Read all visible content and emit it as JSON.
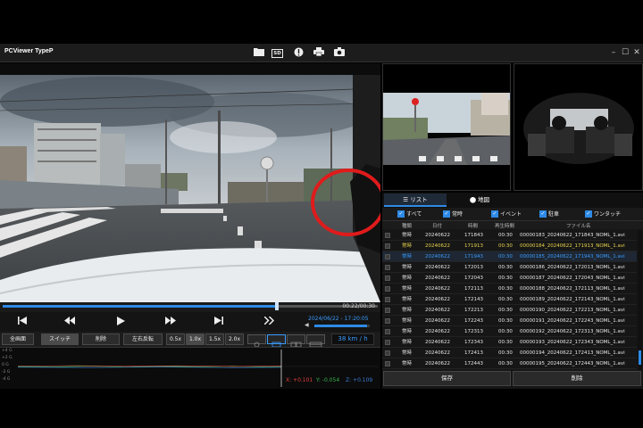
{
  "app": {
    "title": "PCViewer TypeP",
    "toolbar_icons": [
      "folder-icon",
      "sd-card-icon",
      "info-icon",
      "print-icon",
      "camera-icon"
    ],
    "sd_label": "SD",
    "window_controls": {
      "minimize": "–",
      "maximize": "☐",
      "close": "✕"
    }
  },
  "player": {
    "time": "00:22/00:30",
    "progress": 0.73,
    "volume": 0.95,
    "datetime": "2024/06/22 - 17:20:05",
    "speed": "38 km / h",
    "controls": [
      "skip-back",
      "rewind",
      "play",
      "fast-forward",
      "skip-forward",
      "next-clip"
    ]
  },
  "buttons": {
    "fullscreen": "全画面",
    "switch": "スイッチ",
    "delete": "削除",
    "mirror": "左右反転",
    "speeds": [
      "0.5x",
      "1.0x",
      "1.5x",
      "2.0x"
    ],
    "active_speed": "1.0x"
  },
  "gsensor": {
    "scale": [
      "+4 G",
      "+2 G",
      "0 G",
      "-2 G",
      "-4 G"
    ],
    "x": "X: +0.101",
    "y": "Y: -0.054",
    "z": "Z: +0.109",
    "colors": {
      "x": "#e0403c",
      "y": "#37b24d",
      "z": "#3a7bd5"
    }
  },
  "panel": {
    "tabs": {
      "list": "リスト",
      "map": "地図"
    },
    "filters": [
      "すべて",
      "常時",
      "イベント",
      "駐車",
      "ワンタッチ"
    ],
    "columns": [
      "種類",
      "日付",
      "時間",
      "再生時間",
      "ファイル名"
    ],
    "rows": [
      {
        "type": "常時",
        "date": "20240622",
        "time": "171843",
        "dur": "00:30",
        "file": "00000183_20240622_171843_NOML_1.avi",
        "state": "normal"
      },
      {
        "type": "常時",
        "date": "20240622",
        "time": "171913",
        "dur": "00:30",
        "file": "00000184_20240622_171913_NOML_1.avi",
        "state": "yellow"
      },
      {
        "type": "常時",
        "date": "20240622",
        "time": "171943",
        "dur": "00:30",
        "file": "00000185_20240622_171943_NOML_1.avi",
        "state": "selected"
      },
      {
        "type": "常時",
        "date": "20240622",
        "time": "172013",
        "dur": "00:30",
        "file": "00000186_20240622_172013_NOML_1.avi",
        "state": "normal"
      },
      {
        "type": "常時",
        "date": "20240622",
        "time": "172043",
        "dur": "00:30",
        "file": "00000187_20240622_172043_NOML_1.avi",
        "state": "normal"
      },
      {
        "type": "常時",
        "date": "20240622",
        "time": "172113",
        "dur": "00:30",
        "file": "00000188_20240622_172113_NOML_1.avi",
        "state": "normal"
      },
      {
        "type": "常時",
        "date": "20240622",
        "time": "172143",
        "dur": "00:30",
        "file": "00000189_20240622_172143_NOML_1.avi",
        "state": "normal"
      },
      {
        "type": "常時",
        "date": "20240622",
        "time": "172213",
        "dur": "00:30",
        "file": "00000190_20240622_172213_NOML_1.avi",
        "state": "normal"
      },
      {
        "type": "常時",
        "date": "20240622",
        "time": "172243",
        "dur": "00:30",
        "file": "00000191_20240622_172243_NOML_1.avi",
        "state": "normal"
      },
      {
        "type": "常時",
        "date": "20240622",
        "time": "172313",
        "dur": "00:30",
        "file": "00000192_20240622_172313_NOML_1.avi",
        "state": "normal"
      },
      {
        "type": "常時",
        "date": "20240622",
        "time": "172343",
        "dur": "00:30",
        "file": "00000193_20240622_172343_NOML_1.avi",
        "state": "normal"
      },
      {
        "type": "常時",
        "date": "20240622",
        "time": "172413",
        "dur": "00:30",
        "file": "00000194_20240622_172413_NOML_1.avi",
        "state": "normal"
      },
      {
        "type": "常時",
        "date": "20240622",
        "time": "172443",
        "dur": "00:30",
        "file": "00000195_20240622_172443_NOML_1.avi",
        "state": "normal"
      }
    ],
    "save": "保存",
    "delete": "削除"
  },
  "colors": {
    "accent": "#2e8ae6",
    "yellow_row": "#e8d44d",
    "selected_row": "#3a9cff",
    "annotation_circle": "#e01b1b"
  }
}
